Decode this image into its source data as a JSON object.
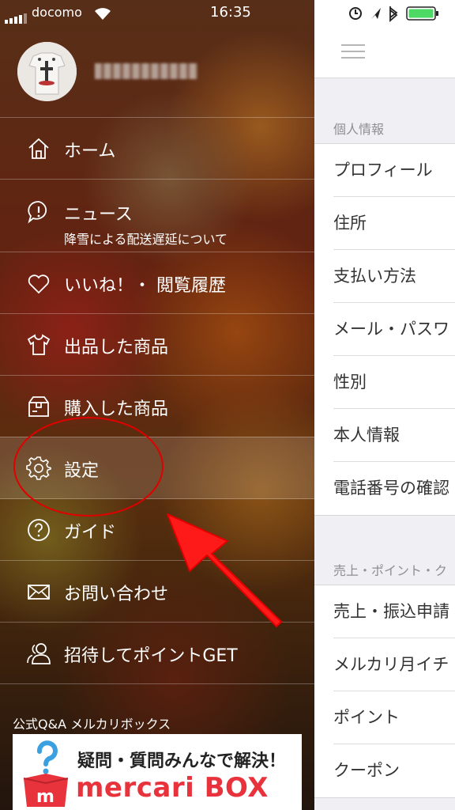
{
  "status": {
    "carrier": "docomo",
    "time": "16:35"
  },
  "drawer": {
    "menu": [
      {
        "label": "ホーム",
        "icon": "home-icon"
      },
      {
        "label": "ニュース",
        "sub": "降雪による配送遅延について",
        "icon": "news-icon"
      },
      {
        "label": "いいね！・ 閲覧履歴",
        "icon": "heart-icon"
      },
      {
        "label": "出品した商品",
        "icon": "tshirt-icon"
      },
      {
        "label": "購入した商品",
        "icon": "box-icon"
      },
      {
        "label": "設定",
        "icon": "gear-icon",
        "selected": true
      },
      {
        "label": "ガイド",
        "icon": "help-icon"
      },
      {
        "label": "お問い合わせ",
        "icon": "mail-icon"
      },
      {
        "label": "招待してポイントGET",
        "icon": "users-icon"
      }
    ],
    "qa_label": "公式Q&A メルカリボックス",
    "banner": {
      "line1": "疑問・質問みんなで解決！",
      "line2": "mercari BOX"
    }
  },
  "settings": {
    "section1": {
      "header": "個人情報",
      "items": [
        "プロフィール",
        "住所",
        "支払い方法",
        "メール・パスワ",
        "性別",
        "本人情報",
        "電話番号の確認"
      ]
    },
    "section2": {
      "header": "売上・ポイント・ク",
      "items": [
        "売上・振込申請",
        "メルカリ月イチ",
        "ポイント",
        "クーポン"
      ]
    }
  },
  "colors": {
    "accent_red": "#e8323c",
    "annotation_red": "#e00000",
    "battery_green": "#4cd964"
  }
}
